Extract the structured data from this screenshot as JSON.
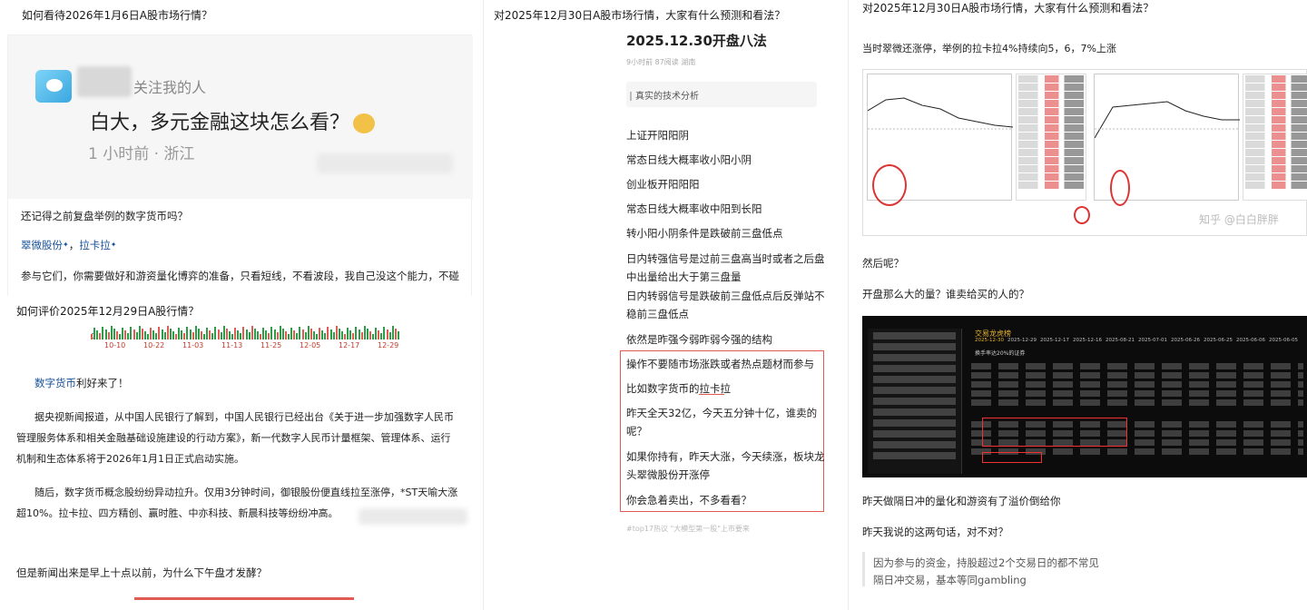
{
  "col1": {
    "title": "如何看待2026年1月6日A股市场行情？",
    "screenshot": {
      "following": "关注我的人",
      "post": "白大，多元金融这块怎么看？",
      "meta": "1 小时前 · 浙江"
    },
    "p1": "还记得之前复盘举例的数字货币吗？",
    "stocks_1": "翠微股份",
    "stocks_sep": "，",
    "stocks_2": "拉卡拉",
    "p2": "参与它们，你需要做好和游资量化博弈的准备，只看短线，不看波段，我自己没这个能力，不碰"
  },
  "col1b": {
    "title": "如何评价2025年12月29日A股行情？",
    "axis_zero": "0",
    "xticks": [
      "10-10",
      "10-22",
      "11-03",
      "11-13",
      "11-25",
      "12-05",
      "12-17",
      "12-29"
    ],
    "line1_link": "数字货币",
    "line1_rest": "利好来了！",
    "para1_l1": "据央视新闻报道，从中国人民银行了解到，中国人民银行已经出台《关于进一步加强数字人民币",
    "para1_l2": "管理服务体系和相关金融基础设施建设的行动方案》，新一代数字人民币计量框架、管理体系、运行",
    "para1_l3": "机制和生态体系将于2026年1月1日正式启动实施。",
    "para2_l1": "随后，数字货币概念股纷纷异动拉升。仅用3分钟时间，御银股份便直线拉至涨停，*ST天喻大涨",
    "para2_l2": "超10%。拉卡拉、四方精创、赢时胜、中亦科技、新晨科技等纷纷冲高。",
    "p3": "但是新闻出来是早上十点以前，为什么下午盘才发酵？"
  },
  "col2": {
    "title": "对2025年12月30日A股市场行情，大家有什么预测和看法？",
    "heading": "2025.12.30开盘八法",
    "meta": "9小时前  87阅读  湖南",
    "tag": "真实的技术分析",
    "items": [
      "上证开阳阳阴",
      "常态日线大概率收小阳小阴",
      "创业板开阳阳阳",
      "常态日线大概率收中阳到长阳",
      "转小阳小阴条件是跌破前三盘低点",
      "日内转强信号是过前三盘高当时或者之后盘",
      "中出量给出大于第三盘量",
      "日内转弱信号是跌破前三盘低点后反弹站不",
      "稳前三盘低点",
      "依然是昨强今弱昨弱今强的结构"
    ],
    "boxed": [
      "操作不要随市场涨跌或者热点题材而参与",
      "比如数字货币的拉卡拉",
      "昨天全天32亿，今天五分钟十亿，谁卖的",
      "呢？",
      "如果你持有，昨天大涨，今天续涨，板块龙",
      "头翠微股份开涨停",
      "你会急着卖出，不多看看？"
    ],
    "footer": "#top17热议 \"大模型第一股\"上市要来"
  },
  "col3": {
    "title": "对2025年12月30日A股市场行情，大家有什么预测和看法？",
    "p1": "当时翠微还涨停，举例的拉卡拉4%持续向5，6，7%上涨",
    "watermark": "知乎 @白白胖胖",
    "p2": "然后呢？",
    "p3": "开盘那么大的量？谁卖给买的人的？",
    "dark": {
      "header": "交易龙虎榜",
      "subheader": "换手率达20%的证券",
      "dates": [
        "2025-12-30",
        "2025-12-29",
        "2025-12-17",
        "2025-12-16",
        "2025-08-21",
        "2025-07-01",
        "2025-06-26",
        "2025-06-25",
        "2025-06-06",
        "2025-06-05"
      ]
    },
    "p4": "昨天做隔日冲的量化和游资有了溢价倒给你",
    "p5": "昨天我说的这两句话，对不对？",
    "quote1": "因为参与的资金，持股超过2个交易日的都不常见",
    "quote2": "隔日冲交易，基本等同gambling"
  },
  "colors": {
    "link": "#175199",
    "red": "#e15b55",
    "bg": "#ffffff"
  }
}
